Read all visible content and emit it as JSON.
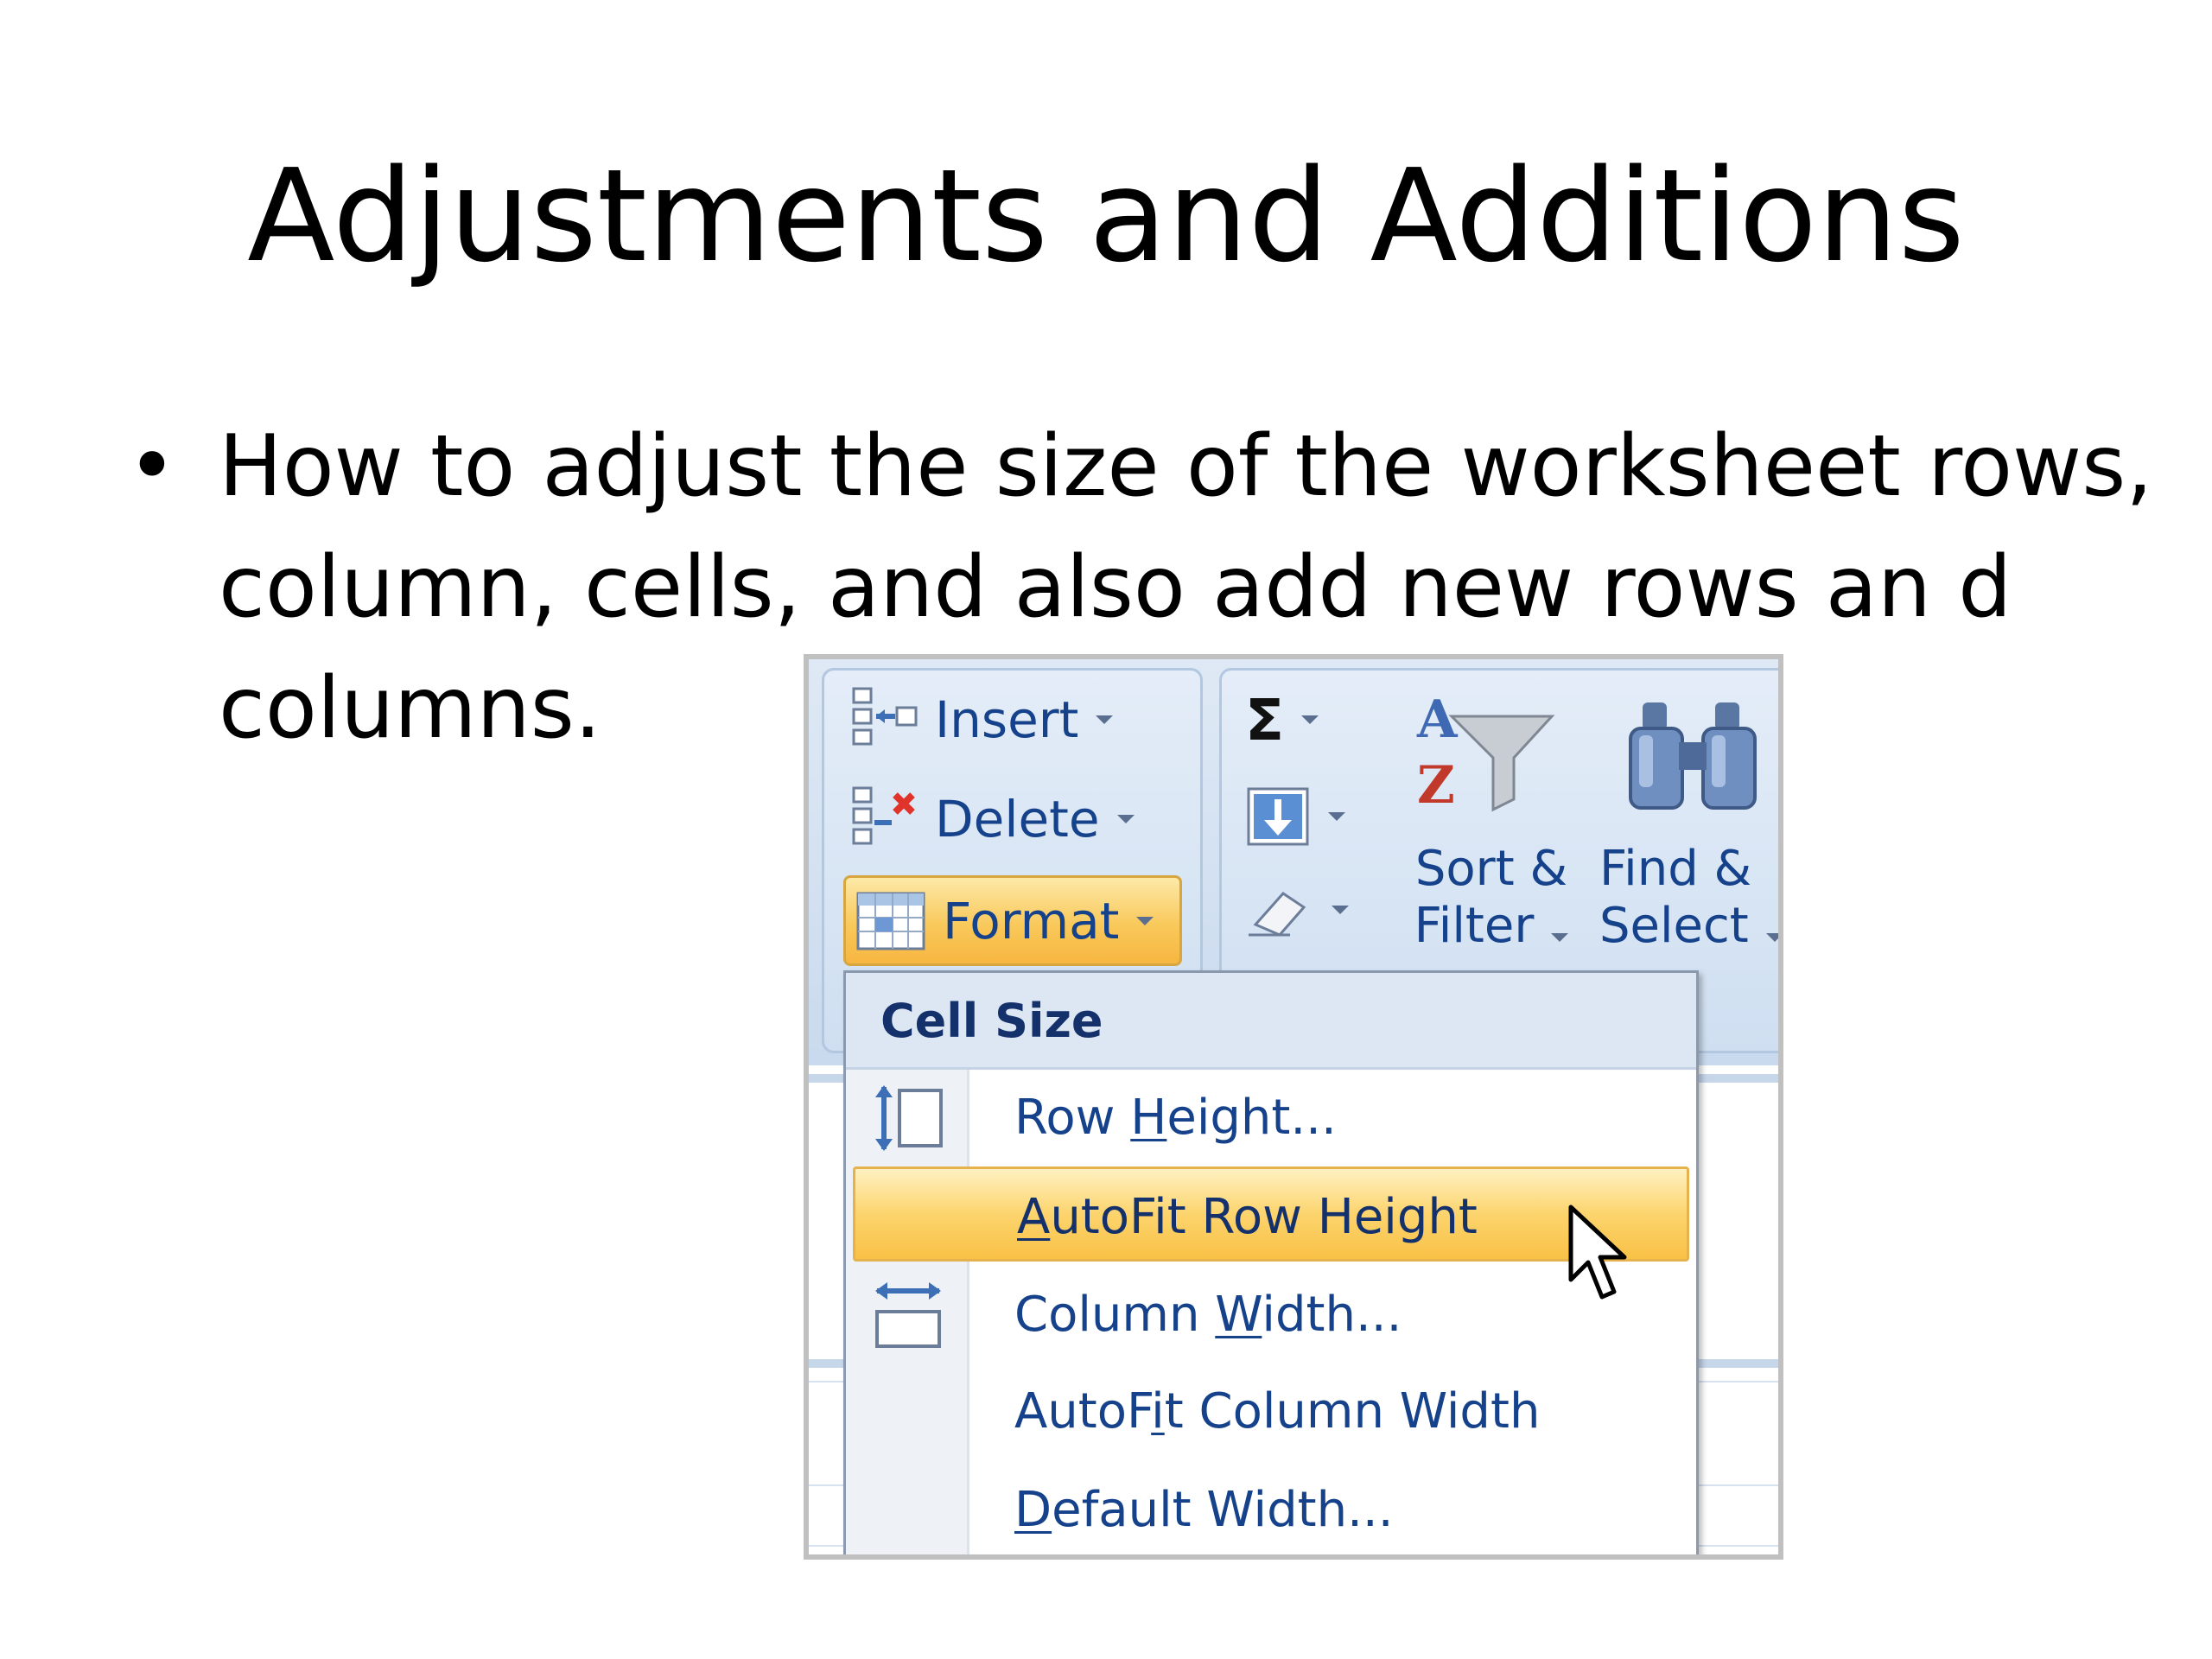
{
  "slide": {
    "title": "Adjustments and Additions",
    "bullet_symbol": "•",
    "bullet_lines": [
      "How to adjust the size of the worksheet rows,",
      "column, cells, and also add new rows an d",
      "columns."
    ]
  },
  "ribbon": {
    "cells_group": {
      "insert_label": "Insert",
      "delete_label": "Delete",
      "format_label": "Format"
    },
    "editing_group": {
      "sum_symbol": "Σ",
      "sort_filter_line1": "Sort &",
      "sort_filter_line2": "Filter",
      "find_select_line1": "Find &",
      "find_select_line2": "Select"
    }
  },
  "format_menu": {
    "section_header": "Cell Size",
    "items": [
      {
        "pre": "Row ",
        "key": "H",
        "post": "eight..."
      },
      {
        "pre": "",
        "key": "A",
        "post": "utoFit Row Height"
      },
      {
        "pre": "Column ",
        "key": "W",
        "post": "idth..."
      },
      {
        "pre": "AutoF",
        "key": "i",
        "post": "t Column Width"
      },
      {
        "pre": "",
        "key": "D",
        "post": "efault Width..."
      }
    ],
    "highlighted_index": 1
  },
  "colors": {
    "ribbon_text": "#15428b",
    "highlight_orange": "#f9c146",
    "ribbon_blue": "#c9daee"
  }
}
